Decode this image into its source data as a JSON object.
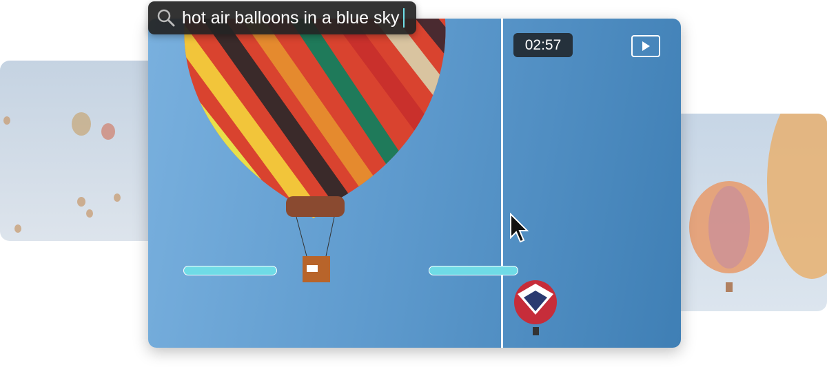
{
  "search": {
    "query": "hot air balloons in a blue sky",
    "icon": "search-icon"
  },
  "video": {
    "timestamp": "02:57",
    "play_icon": "play-icon"
  },
  "colors": {
    "accent": "#6fdbe6",
    "sky": "#5f9bce",
    "badge": "#25313c"
  }
}
